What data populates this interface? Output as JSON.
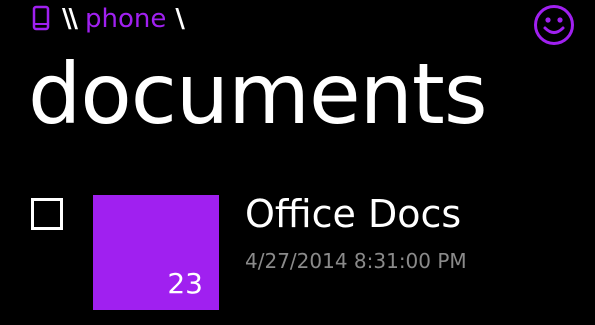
{
  "colors": {
    "accent": "#a020f0",
    "background": "#000000",
    "text": "#ffffff",
    "secondary_text": "#8a8a8a"
  },
  "breadcrumb": {
    "icon": "phone-icon",
    "root_separator": "\\\\",
    "crumb": "phone",
    "trailing_separator": "\\"
  },
  "header": {
    "action_icon": "smiley-icon"
  },
  "page": {
    "title": "documents"
  },
  "items": [
    {
      "title": "Office Docs",
      "timestamp": "4/27/2014 8:31:00 PM",
      "count": "23",
      "icon": "folder-tile",
      "checked": false
    }
  ]
}
